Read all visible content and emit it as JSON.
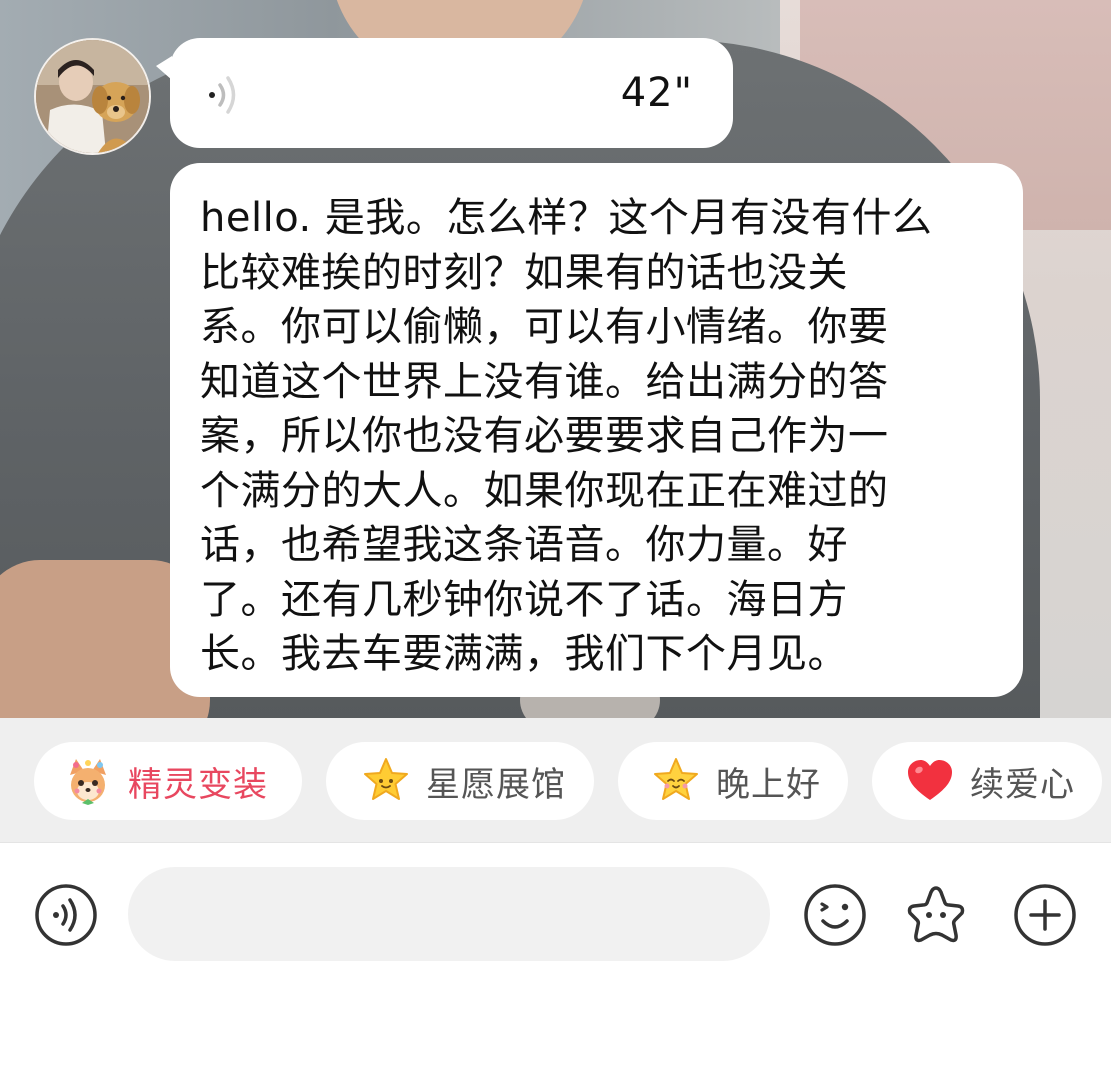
{
  "message": {
    "voice_duration": "42\"",
    "transcript": "hello. 是我。怎么样？这个月有没有什么\n比较难挨的时刻？如果有的话也没关\n系。你可以偷懒，可以有小情绪。你要\n知道这个世界上没有谁。给出满分的答\n案，所以你也没有必要要求自己作为一\n个满分的大人。如果你现在正在难过的\n话，也希望我这条语音。你力量。好\n了。还有几秒钟你说不了话。海日方\n长。我去车要满满，我们下个月见。"
  },
  "quick_actions": [
    {
      "label": "精灵变装",
      "icon": "fox-elf-icon"
    },
    {
      "label": "星愿展馆",
      "icon": "star-icon"
    },
    {
      "label": "晚上好",
      "icon": "star-face-icon"
    },
    {
      "label": "续爱心",
      "icon": "heart-icon"
    }
  ],
  "composer": {
    "input_value": "",
    "input_placeholder": ""
  },
  "colors": {
    "accent_chip_text": "#e8475f",
    "chip_text": "#555555",
    "bubble": "#ffffff",
    "chip_bar_bg": "#efefef",
    "input_bg": "#f1f1f1"
  }
}
